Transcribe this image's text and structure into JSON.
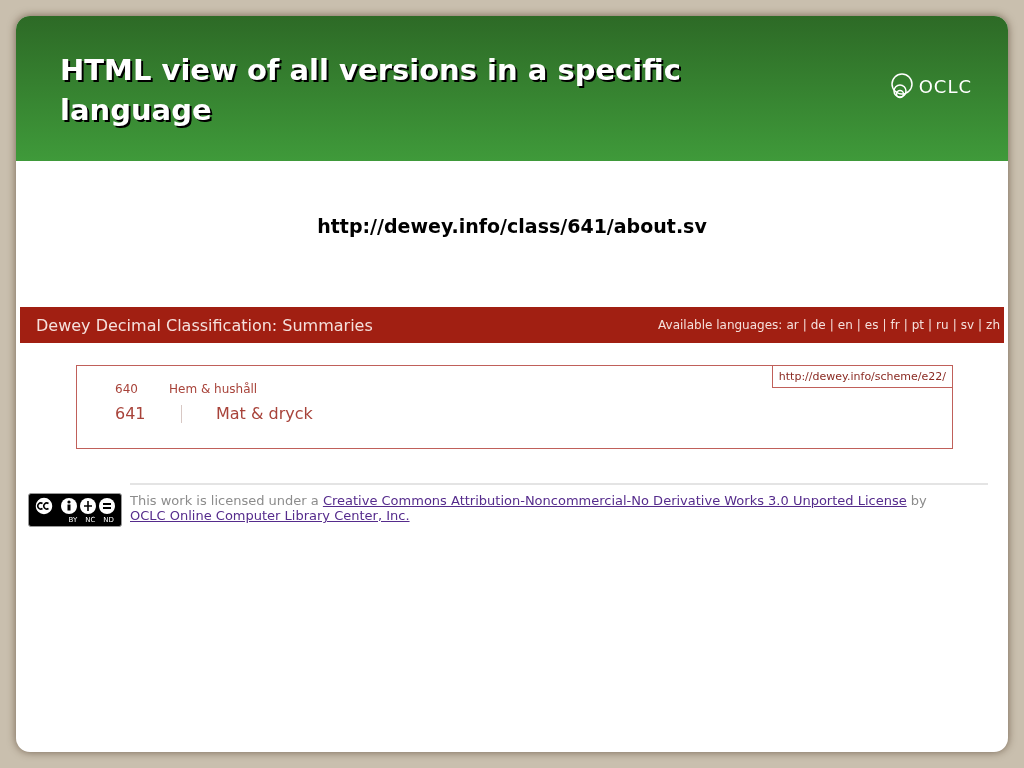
{
  "slide": {
    "title": "HTML view of all versions in a specific language",
    "logo_text": "OCLC",
    "url": "http://dewey.info/class/641/about.sv"
  },
  "web_page": {
    "header": {
      "title": "Dewey Decimal Classification: Summaries",
      "languages_label": "Available languages:",
      "separator": "|",
      "languages": [
        {
          "code": "ar"
        },
        {
          "code": "de"
        },
        {
          "code": "en"
        },
        {
          "code": "es"
        },
        {
          "code": "fr"
        },
        {
          "code": "pt"
        },
        {
          "code": "ru"
        },
        {
          "code": "sv"
        },
        {
          "code": "zh"
        }
      ]
    },
    "scheme_link": "http://dewey.info/scheme/e22/",
    "parent": {
      "notation": "640",
      "caption": "Hem & hushåll"
    },
    "current": {
      "notation": "641",
      "caption": "Mat & dryck"
    },
    "license": {
      "badge_labels": [
        "BY",
        "NC",
        "ND"
      ],
      "text_before": "This work is licensed under a",
      "license_link": "Creative Commons Attribution-Noncommercial-No Derivative Works 3.0 Unported License",
      "text_between": "by",
      "owner_link": "OCLC Online Computer Library Center, Inc."
    }
  }
}
